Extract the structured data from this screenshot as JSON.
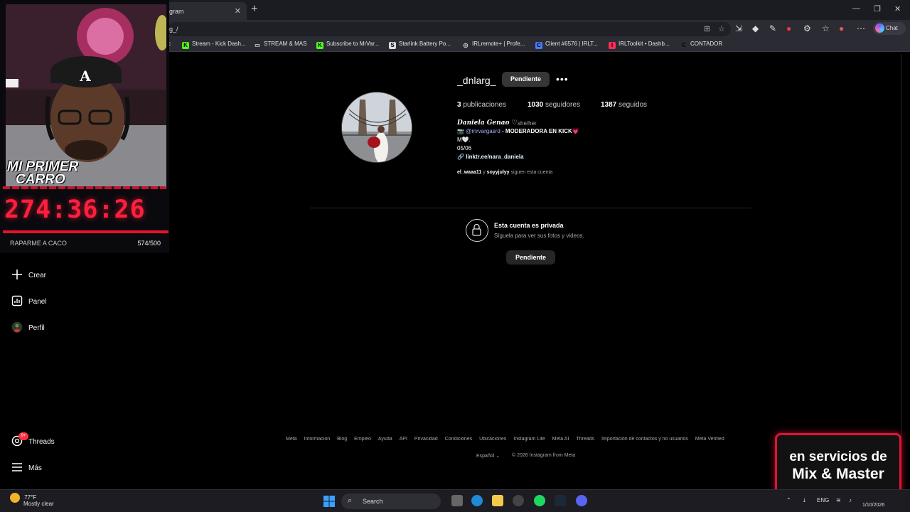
{
  "browser": {
    "tab_title": "gram",
    "url": "g_/",
    "chat_label": "Chat",
    "bookmarks": [
      {
        "label": "Stream - Kick Dash...",
        "color": "#53fc18",
        "glyph": "K"
      },
      {
        "label": "STREAM & MAS",
        "color": "#2b2b33",
        "glyph": "folder"
      },
      {
        "label": "Subscribe to MrVar...",
        "color": "#53fc18",
        "glyph": "K"
      },
      {
        "label": "Starlink Battery Po...",
        "color": "#dddddd",
        "glyph": "S"
      },
      {
        "label": "IRLremote+ | Profe...",
        "color": "#2b2b33",
        "glyph": "globe"
      },
      {
        "label": "Client #6576 | IRLT...",
        "color": "#4a7cff",
        "glyph": "C"
      },
      {
        "label": "IRLToolkit • Dashb...",
        "color": "#ff2c55",
        "glyph": "I"
      },
      {
        "label": "CONTADOR",
        "color": "#2b2b33",
        "glyph": "C"
      }
    ]
  },
  "profile": {
    "username": "_dnlarg_",
    "follow_status": "Pendiente",
    "posts_count": "3",
    "posts_label": "publicaciones",
    "followers_count": "1030",
    "followers_label": "seguidores",
    "following_count": "1387",
    "following_label": "seguidos",
    "full_name": "Daniela Genao ♡",
    "pronouns": "she/her",
    "bio_mention": "@mrvargasrd",
    "bio_mention_rest": "- MODERADORA EN KICK💗",
    "bio_line2": "M🤍.",
    "bio_line3": "05/06",
    "link": "linktr.ee/nara_daniela",
    "followed_by_1": "el_waaa11",
    "followed_by_joiner": "y",
    "followed_by_2": "soyyjulyy",
    "followed_by_suffix": "siguen esta cuenta"
  },
  "private": {
    "title": "Esta cuenta es privada",
    "subtitle": "Síguela para ver sus fotos y videos.",
    "button": "Pendiente"
  },
  "nav": {
    "create": "Crear",
    "panel": "Panel",
    "profile": "Perfil",
    "threads": "Threads",
    "threads_badge": "9+",
    "more": "Más"
  },
  "footer": {
    "links": [
      "Meta",
      "Información",
      "Blog",
      "Empleo",
      "Ayuda",
      "API",
      "Privacidad",
      "Condiciones",
      "Ubicaciones",
      "Instagram Lite",
      "Meta AI",
      "Threads",
      "Importación de contactos y no usuarios",
      "Meta Verified"
    ],
    "language": "Español",
    "copyright": "© 2026 Instagram from Meta"
  },
  "stream_overlay": {
    "title_line1": "MI PRIMER",
    "title_line2": "CARRO",
    "timer": "274:36:26",
    "goal_label": "RAPARME A CACO",
    "goal_count": "574/500",
    "goal_progress": 1.0
  },
  "promo": {
    "line1": "en servicios de",
    "line2": "Mix & Master"
  },
  "taskbar": {
    "temperature": "77°F",
    "weather": "Mostly clear",
    "search_label": "Search",
    "language": "ENG",
    "date": "1/10/2026"
  }
}
